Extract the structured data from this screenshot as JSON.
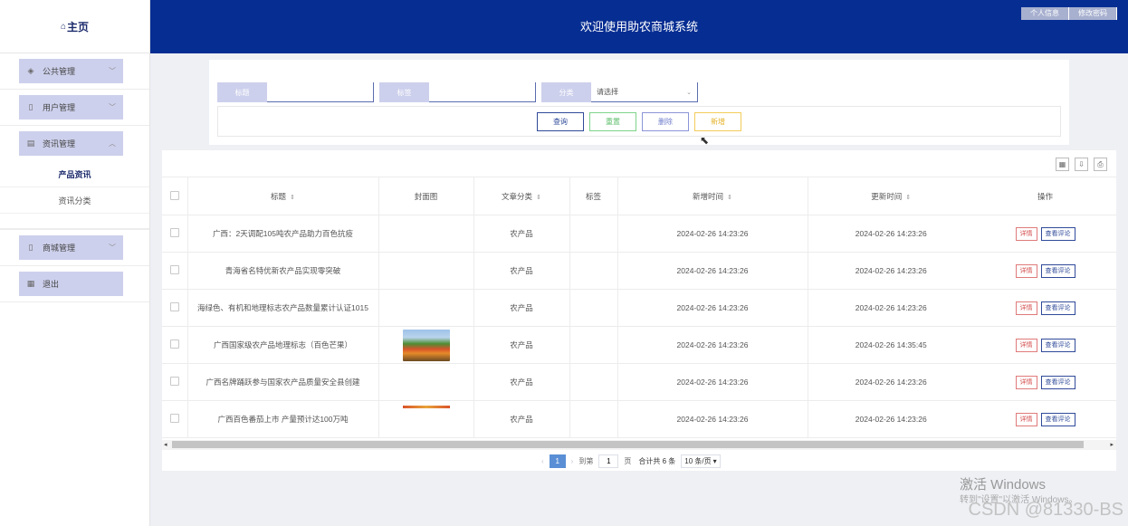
{
  "sidebar": {
    "logo": "主页",
    "menu": [
      {
        "label": "公共管理",
        "icon": "layers-icon"
      },
      {
        "label": "用户管理",
        "icon": "user-icon"
      },
      {
        "label": "资讯管理",
        "icon": "list-icon",
        "expanded": true,
        "children": [
          {
            "label": "产品资讯",
            "active": true
          },
          {
            "label": "资讯分类",
            "active": false
          }
        ]
      },
      {
        "label": "商城管理",
        "icon": "shop-icon"
      },
      {
        "label": "退出",
        "icon": "exit-icon"
      }
    ]
  },
  "header": {
    "title": "欢迎使用助农商城系统",
    "profile_btn": "个人信息",
    "password_btn": "修改密码"
  },
  "search": {
    "title_label": "标题",
    "title_value": "",
    "tag_label": "标签",
    "tag_value": "",
    "category_label": "分类",
    "category_placeholder": "请选择",
    "query_btn": "查询",
    "reset_btn": "重置",
    "delete_btn": "删除",
    "add_btn": "新增"
  },
  "table": {
    "columns": [
      "标题",
      "封面图",
      "文章分类",
      "标签",
      "新增时间",
      "更新时间",
      "操作"
    ],
    "rows": [
      {
        "title": "广西：2天调配105吨农产品助力百色抗疫",
        "has_cover": false,
        "category": "农产品",
        "tag": "",
        "created": "2024-02-26 14:23:26",
        "updated": "2024-02-26 14:23:26"
      },
      {
        "title": "青海省名特优新农产品实现零突破",
        "has_cover": false,
        "category": "农产品",
        "tag": "",
        "created": "2024-02-26 14:23:26",
        "updated": "2024-02-26 14:23:26"
      },
      {
        "title": "海绿色、有机和地理标志农产品数量累计认证1015",
        "has_cover": false,
        "category": "农产品",
        "tag": "",
        "created": "2024-02-26 14:23:26",
        "updated": "2024-02-26 14:23:26"
      },
      {
        "title": "广西国家级农产品地理标志（百色芒果）",
        "has_cover": true,
        "category": "农产品",
        "tag": "",
        "created": "2024-02-26 14:23:26",
        "updated": "2024-02-26 14:35:45"
      },
      {
        "title": "广西名牌踊跃参与国家农产品质量安全县创建",
        "has_cover": false,
        "category": "农产品",
        "tag": "",
        "created": "2024-02-26 14:23:26",
        "updated": "2024-02-26 14:23:26"
      },
      {
        "title": "广西百色番茄上市 产量预计达100万吨",
        "has_cover": "strip",
        "category": "农产品",
        "tag": "",
        "created": "2024-02-26 14:23:26",
        "updated": "2024-02-26 14:23:26"
      }
    ],
    "detail_btn": "详情",
    "comment_btn": "查看评论"
  },
  "pager": {
    "current": "1",
    "goto_label": "到第",
    "goto_value": "1",
    "page_unit": "页",
    "total": "合计共 6 条",
    "page_size": "10 条/页"
  },
  "watermark": {
    "windows": "激活 Windows",
    "windows_sub": "转到\"设置\"以激活 Windows。",
    "csdn": "CSDN @81330-BS"
  }
}
